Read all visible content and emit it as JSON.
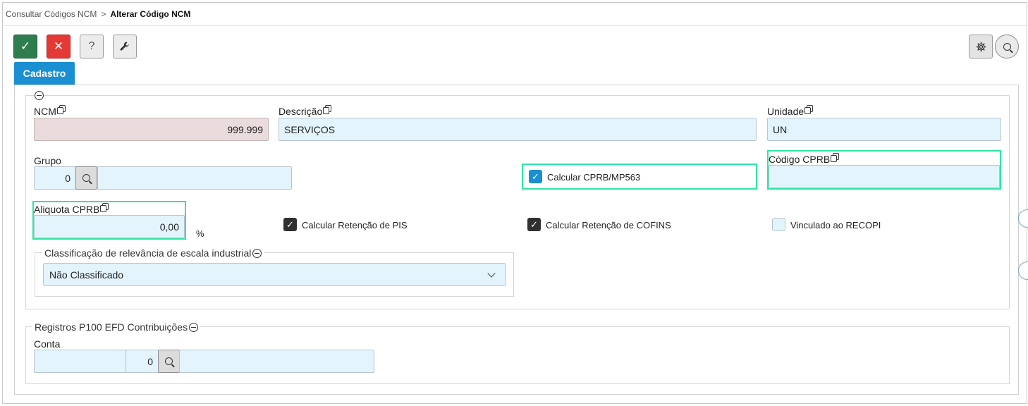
{
  "breadcrumb": {
    "parent": "Consultar Códigos NCM",
    "separator": ">",
    "current": "Alterar Código NCM"
  },
  "toolbar": {
    "confirm_glyph": "✓",
    "cancel_glyph": "✕",
    "help_glyph": "?",
    "icons": [
      "check-icon",
      "close-icon",
      "question-icon",
      "wrench-icon",
      "gear-icon",
      "search-icon"
    ]
  },
  "tabs": [
    {
      "label": "Cadastro",
      "active": true
    }
  ],
  "form": {
    "ncm": {
      "label": "NCM",
      "value": "999.999"
    },
    "descricao": {
      "label": "Descrição",
      "value": "SERVIÇOS"
    },
    "unidade": {
      "label": "Unidade",
      "value": "UN"
    },
    "grupo": {
      "label": "Grupo",
      "code": "0",
      "description": ""
    },
    "calcular_cprb": {
      "label": "Calcular CPRB/MP563",
      "checked": true
    },
    "codigo_cprb": {
      "label": "Código CPRB",
      "value": ""
    },
    "aliquota_cprb": {
      "label": "Aliquota CPRB",
      "value": "0,00",
      "unit": "%"
    },
    "retencao_pis": {
      "label": "Calcular Retenção de PIS",
      "checked": true
    },
    "retencao_cofins": {
      "label": "Calcular Retenção de COFINS",
      "checked": true
    },
    "recopi": {
      "label": "Vinculado ao RECOPI",
      "checked": false
    },
    "classificacao": {
      "legend": "Classificação de relevância de escala industrial",
      "selected": "Não Classificado"
    }
  },
  "registros": {
    "legend": "Registros P100 EFD Contribuições",
    "conta": {
      "label": "Conta",
      "account": "",
      "code": "0",
      "description": ""
    }
  },
  "colors": {
    "accent": "#1a8fd1",
    "confirm": "#2e7d4f",
    "cancel": "#e53935",
    "input_bg": "#e4f4fc",
    "readonly_bg": "#eadcdc",
    "highlight": "#2ee6a5"
  }
}
